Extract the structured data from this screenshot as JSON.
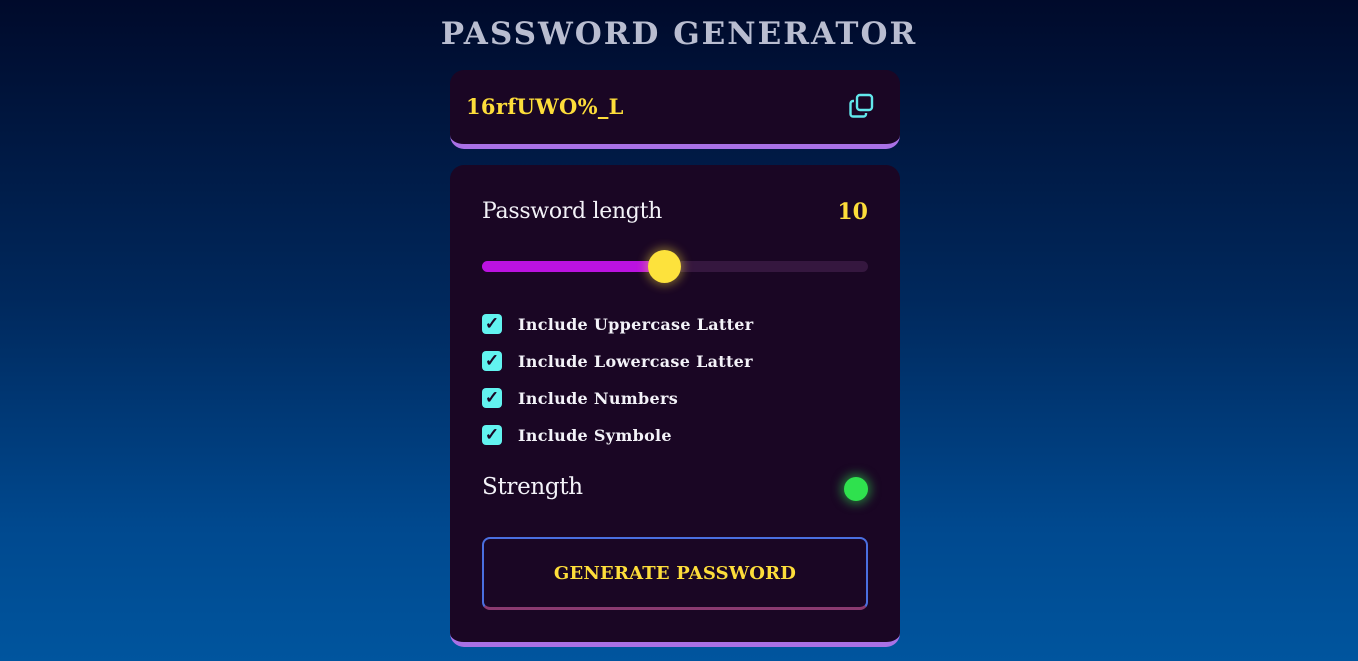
{
  "app": {
    "title": "PASSWORD GENERATOR"
  },
  "display": {
    "password": "16rfUWO%_L",
    "copy_icon": "copy-icon"
  },
  "length": {
    "label": "Password length",
    "value": "10",
    "slider_fraction": 0.475
  },
  "options": [
    {
      "label": "Include Uppercase Latter",
      "checked": true
    },
    {
      "label": "Include Lowercase Latter",
      "checked": true
    },
    {
      "label": "Include Numbers",
      "checked": true
    },
    {
      "label": "Include Symbole",
      "checked": true
    }
  ],
  "strength": {
    "label": "Strength",
    "color": "#2fe14e"
  },
  "generate": {
    "label": "GENERATE PASSWORD"
  },
  "colors": {
    "accent_yellow": "#fddd3a",
    "slider_fill": "#bb12e0",
    "checkbox": "#62f3f0",
    "card_bg": "#1a0624",
    "card_border": "#a971e6"
  }
}
